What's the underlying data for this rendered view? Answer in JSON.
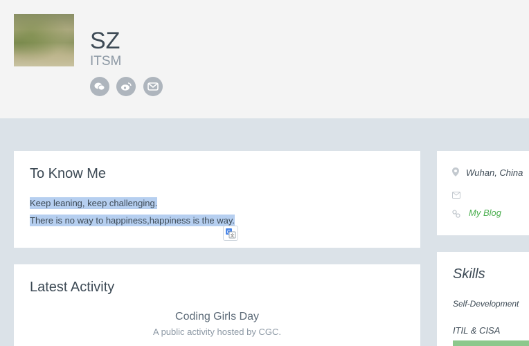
{
  "profile": {
    "name": "SZ",
    "role": "ITSM"
  },
  "social": [
    "wechat-icon",
    "weibo-icon",
    "mail-icon"
  ],
  "about": {
    "title": "To Know Me",
    "lines": [
      "Keep leaning, keep challenging.",
      "There is no way to happiness,happiness is the way."
    ]
  },
  "activity": {
    "title": "Latest Activity",
    "event_title": "Coding Girls Day",
    "event_desc": "A public activity hosted by CGC."
  },
  "contact": {
    "location": "Wuhan, China",
    "blog": "My Blog",
    "link_color": "#4caf50"
  },
  "skills": {
    "title": "Skills",
    "items": [
      "Self-Development",
      "ITIL & CISA"
    ],
    "bar_color": "#8cc88c"
  }
}
